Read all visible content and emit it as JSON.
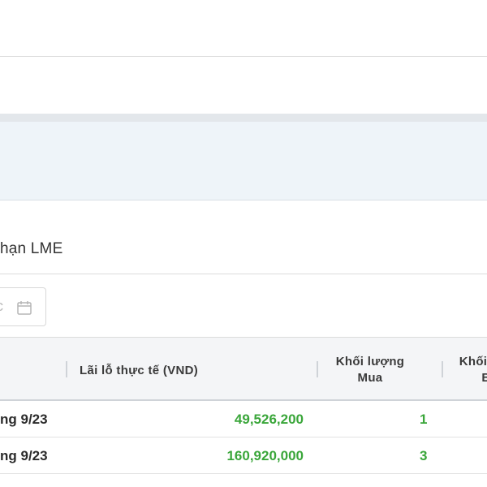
{
  "section": {
    "title": "hạn LME"
  },
  "filters": {
    "date_arrow": "c",
    "calendar_icon": "calendar-icon"
  },
  "table": {
    "headers": {
      "realized_pnl": "Lãi lỗ thực tế (VND)",
      "buy_volume": "Khối lượng Mua",
      "sell_volume": "Khối lượng Bán"
    },
    "rows": [
      {
        "contract": "ng 9/23",
        "realized_pnl": "49,526,200",
        "buy_volume": "1"
      },
      {
        "contract": "ng 9/23",
        "realized_pnl": "160,920,000",
        "buy_volume": "3"
      }
    ]
  },
  "colors": {
    "profit_green": "#3aa63a",
    "panel_blue": "#eef4f9",
    "header_bg": "#f4f5f7"
  }
}
